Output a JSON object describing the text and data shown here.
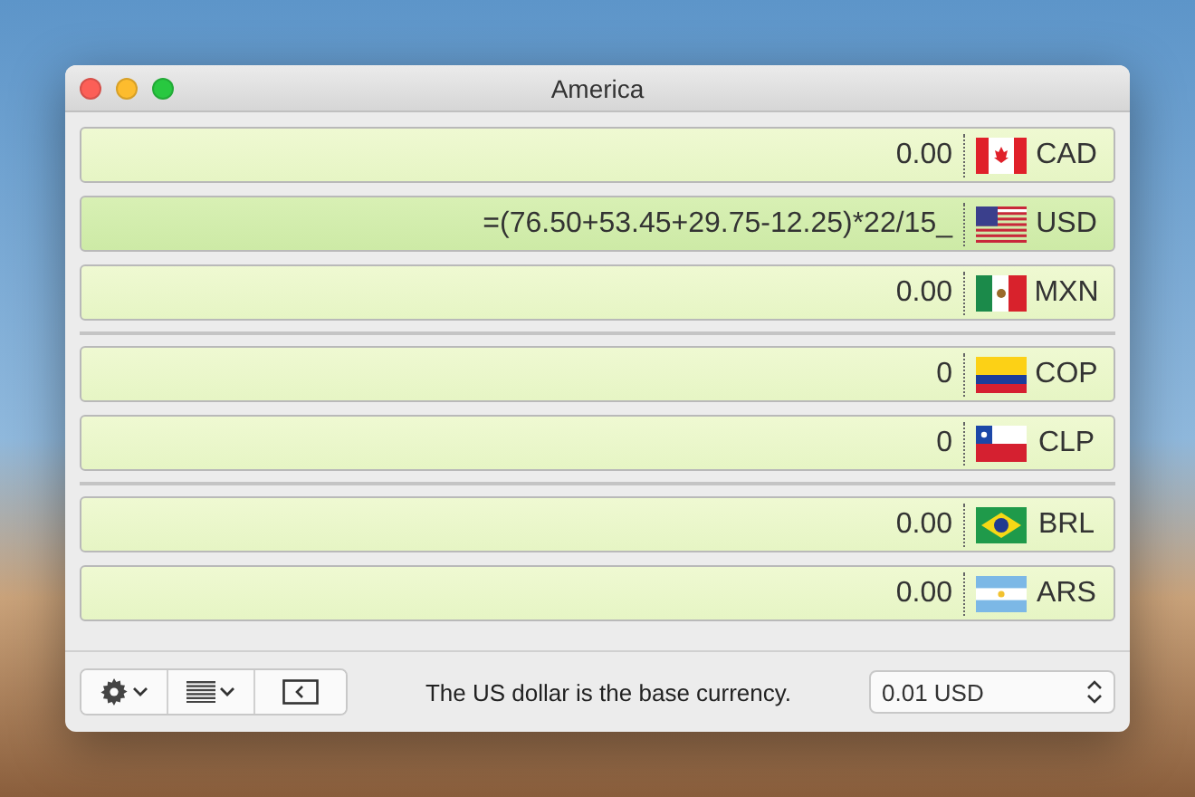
{
  "window": {
    "title": "America"
  },
  "groups": [
    {
      "rows": [
        {
          "amount": "0.00",
          "kind": "ca",
          "code": "CAD",
          "selected": false
        },
        {
          "amount": "=(76.50+53.45+29.75-12.25)*22/15_",
          "kind": "us",
          "code": "USD",
          "selected": true
        },
        {
          "amount": "0.00",
          "kind": "mx",
          "code": "MXN",
          "selected": false
        }
      ]
    },
    {
      "rows": [
        {
          "amount": "0",
          "kind": "co",
          "code": "COP",
          "selected": false
        },
        {
          "amount": "0",
          "kind": "cl",
          "code": "CLP",
          "selected": false
        }
      ]
    },
    {
      "rows": [
        {
          "amount": "0.00",
          "kind": "br",
          "code": "BRL",
          "selected": false
        },
        {
          "amount": "0.00",
          "kind": "ar",
          "code": "ARS",
          "selected": false
        }
      ]
    }
  ],
  "footer": {
    "message": "The US dollar is the base currency.",
    "rounding": "0.01 USD"
  }
}
